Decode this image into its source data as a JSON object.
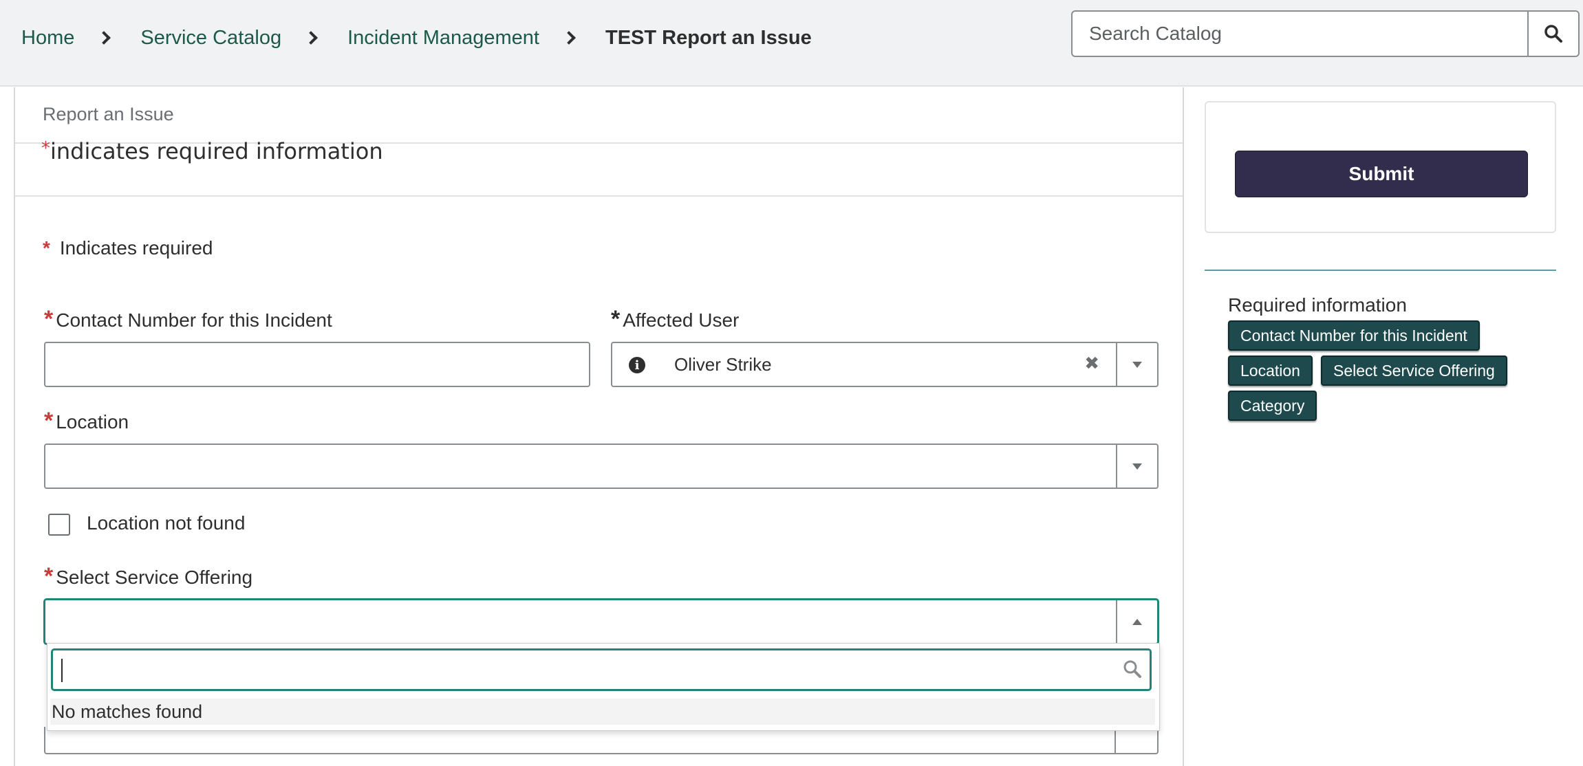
{
  "breadcrumb": {
    "items": [
      "Home",
      "Service Catalog",
      "Incident Management"
    ],
    "current": "TEST Report an Issue"
  },
  "search": {
    "placeholder": "Search Catalog"
  },
  "form": {
    "subtitle": "Report an Issue",
    "required_info_text": "indicates required information",
    "indicates_required": "Indicates required",
    "fields": {
      "contact_number": {
        "label": "Contact Number for this Incident",
        "value": ""
      },
      "affected_user": {
        "label": "Affected User",
        "value": "Oliver Strike"
      },
      "location": {
        "label": "Location",
        "value": ""
      },
      "location_not_found": {
        "label": "Location not found",
        "checked": false
      },
      "service_offering": {
        "label": "Select Service Offering",
        "value": ""
      }
    },
    "dropdown": {
      "search_value": "",
      "no_matches": "No matches found"
    }
  },
  "sidebar": {
    "submit_label": "Submit",
    "required_info_title": "Required information",
    "required_chips": [
      "Contact Number for this Incident",
      "Location",
      "Select Service Offering",
      "Category"
    ]
  },
  "colors": {
    "link": "#1b5a48",
    "required_star": "#c83c3c",
    "submit_bg": "#322d4d",
    "chip_bg": "#1e4a4d",
    "focus": "#1f8576"
  },
  "icons": {
    "breadcrumb_separator": "chevron-right-icon",
    "search": "search-icon",
    "info": "info-icon",
    "clear": "clear-icon",
    "dropdown": "caret-down-icon",
    "dropdown_open": "caret-up-icon"
  }
}
